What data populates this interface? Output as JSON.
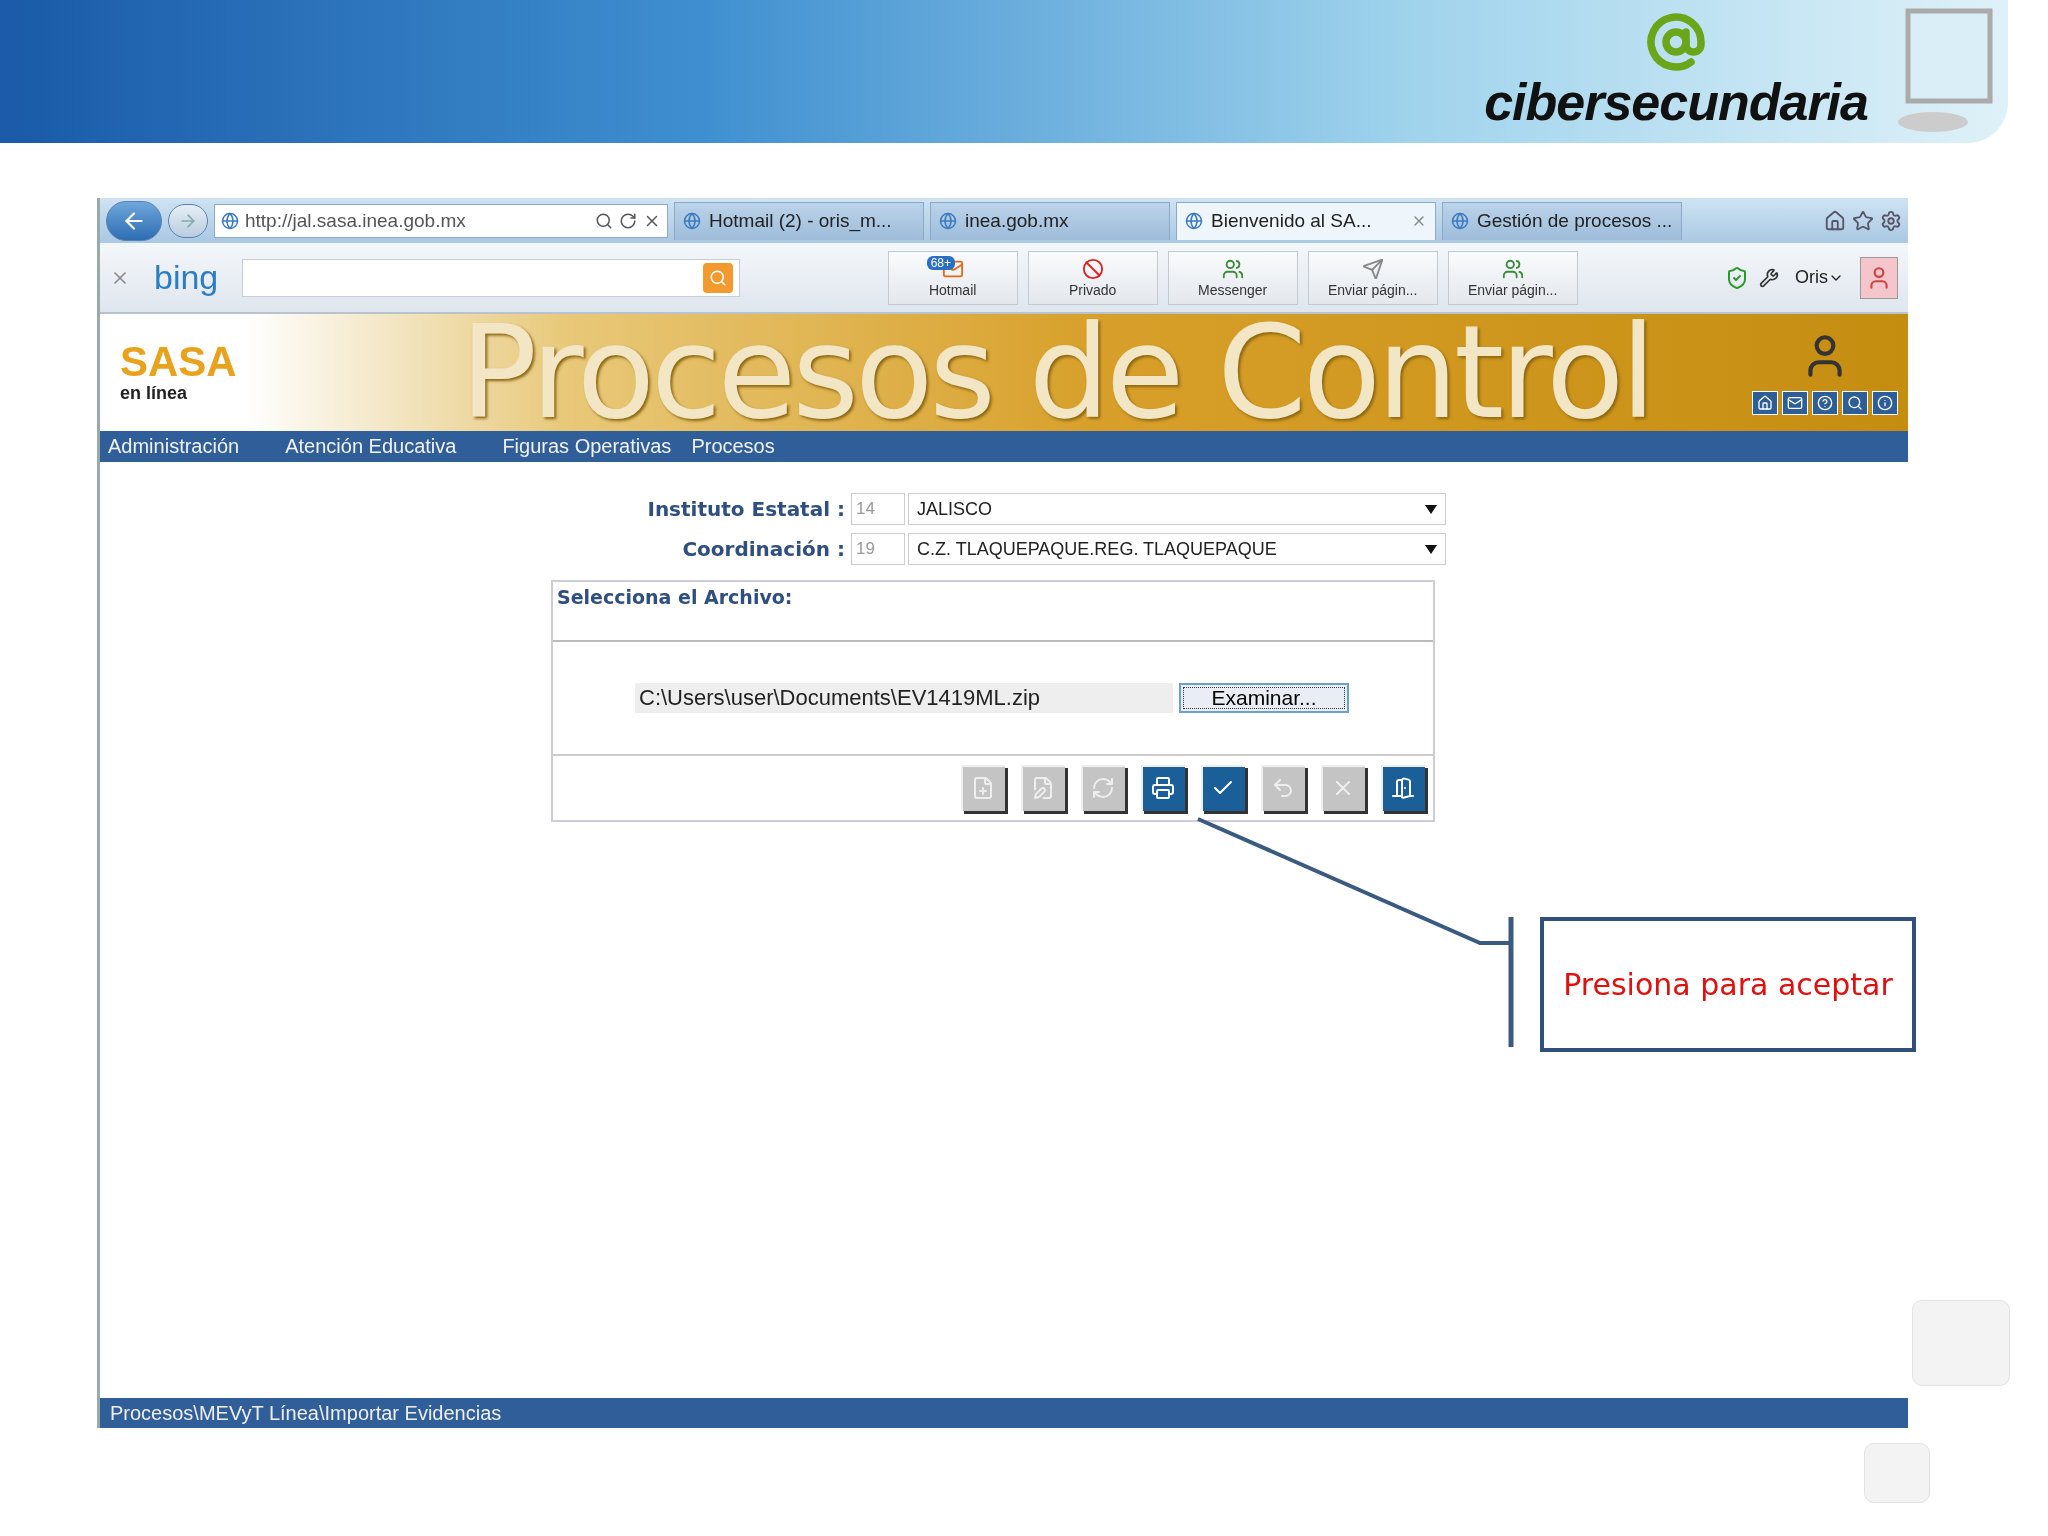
{
  "slide_header": {
    "logo_text": "cibersecundaria"
  },
  "browser": {
    "address": "http://jal.sasa.inea.gob.mx",
    "tabs": [
      {
        "label": "Hotmail (2) - oris_m...",
        "selected": false
      },
      {
        "label": "inea.gob.mx",
        "selected": false
      },
      {
        "label": "Bienvenido al SA...",
        "selected": true
      },
      {
        "label": "Gestión de procesos ...",
        "selected": false
      }
    ],
    "search_logo": "bing",
    "toolbar_buttons": [
      {
        "kind": "mail",
        "label": "Hotmail",
        "badge": "68+"
      },
      {
        "kind": "private",
        "label": "Privado"
      },
      {
        "kind": "messenger",
        "label": "Messenger"
      },
      {
        "kind": "send",
        "label": "Enviar págin..."
      },
      {
        "kind": "messenger",
        "label": "Enviar págin..."
      }
    ],
    "user": "Oris"
  },
  "site": {
    "logo": "SASA",
    "logo_subtitle": "en línea",
    "banner_title": "Procesos de Control",
    "menu": [
      "Administración",
      "Atención Educativa",
      "Figuras Operativas",
      "Procesos"
    ]
  },
  "form": {
    "fields": [
      {
        "label": "Instituto Estatal :",
        "code": "14",
        "value": "JALISCO"
      },
      {
        "label": "Coordinación :",
        "code": "19",
        "value": "C.Z. TLAQUEPAQUE.REG. TLAQUEPAQUE"
      }
    ],
    "file_section": {
      "title": "Selecciona el Archivo:",
      "path": "C:\\Users\\user\\Documents\\EV1419ML.zip",
      "browse_button": "Examinar..."
    },
    "actions": [
      {
        "kind": "new",
        "disabled": true
      },
      {
        "kind": "edit",
        "disabled": true
      },
      {
        "kind": "refresh",
        "disabled": true
      },
      {
        "kind": "print",
        "disabled": false
      },
      {
        "kind": "accept",
        "disabled": false
      },
      {
        "kind": "undo",
        "disabled": true
      },
      {
        "kind": "delete",
        "disabled": true
      },
      {
        "kind": "exit",
        "disabled": false
      }
    ]
  },
  "status_bar": "Procesos\\MEVyT Línea\\Importar Evidencias",
  "callout": {
    "text": "Presiona para aceptar"
  }
}
